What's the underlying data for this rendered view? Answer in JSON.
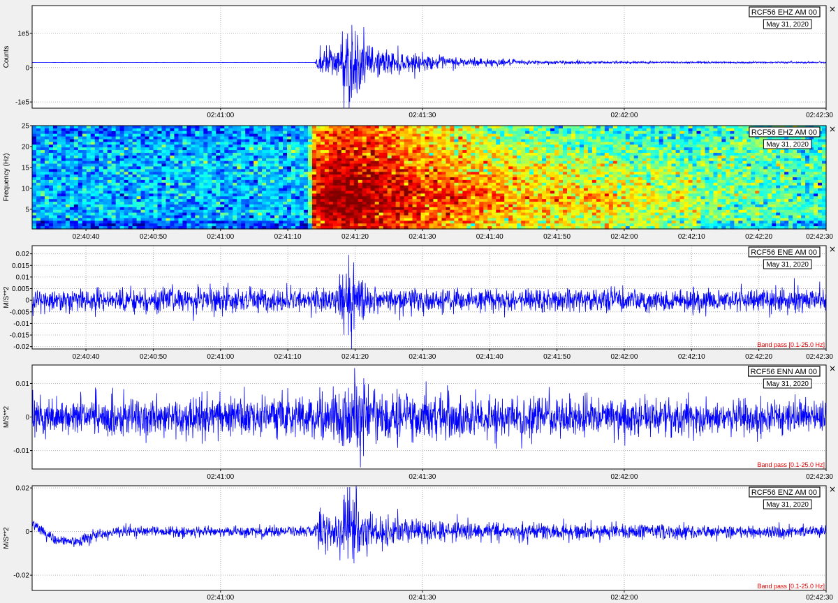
{
  "colors": {
    "trace": "#0000ff",
    "filter_text": "#e00000",
    "grid": "#b0b0b0",
    "plot_bg": "#ffffff",
    "window_bg": "#f0f0f0"
  },
  "close_label": "×",
  "chart_data": [
    {
      "id": "ehz-waveform",
      "type": "line",
      "station": "RCF56 EHZ AM 00",
      "date": "May 31, 2020",
      "ylabel": "Counts",
      "yticks": [
        {
          "v": 100000,
          "label": "1e5"
        },
        {
          "v": 0,
          "label": "0"
        },
        {
          "v": -100000,
          "label": "-1e5"
        }
      ],
      "ylim": [
        -118000,
        180000
      ],
      "xlim": [
        "02:40:32",
        "02:42:30"
      ],
      "xticks": [
        "02:41:00",
        "02:41:30",
        "02:42:00",
        "02:42:30"
      ],
      "baseline": 15000,
      "grid": true,
      "envelope": [
        {
          "x": "02:40:32",
          "amp": 150
        },
        {
          "x": "02:41:14",
          "amp": 150
        },
        {
          "x": "02:41:15",
          "amp": 80000
        },
        {
          "x": "02:41:17",
          "amp": 45000
        },
        {
          "x": "02:41:19",
          "amp": 165000
        },
        {
          "x": "02:41:22",
          "amp": 55000
        },
        {
          "x": "02:41:30",
          "amp": 25000
        },
        {
          "x": "02:41:45",
          "amp": 8000
        },
        {
          "x": "02:42:00",
          "amp": 4000
        },
        {
          "x": "02:42:30",
          "amp": 2500
        }
      ],
      "filter": ""
    },
    {
      "id": "ehz-spectrogram",
      "type": "heatmap",
      "station": "RCF56 EHZ AM 00",
      "date": "May 31, 2020",
      "ylabel": "Frequency (Hz)",
      "yticks": [
        {
          "v": 5,
          "label": "5"
        },
        {
          "v": 10,
          "label": "10"
        },
        {
          "v": 15,
          "label": "15"
        },
        {
          "v": 20,
          "label": "20"
        },
        {
          "v": 25,
          "label": "25"
        }
      ],
      "ylim": [
        0.3,
        25
      ],
      "xlim": [
        "02:40:32",
        "02:42:30"
      ],
      "xticks": [
        "02:40:40",
        "02:40:50",
        "02:41:00",
        "02:41:10",
        "02:41:20",
        "02:41:30",
        "02:41:40",
        "02:41:50",
        "02:42:00",
        "02:42:10",
        "02:42:20",
        "02:42:30"
      ],
      "colormap": "jet",
      "intensity_profile": [
        {
          "x": "02:40:32",
          "level": 0.3
        },
        {
          "x": "02:41:13",
          "level": 0.32
        },
        {
          "x": "02:41:14",
          "level": 0.85
        },
        {
          "x": "02:41:19",
          "level": 0.95
        },
        {
          "x": "02:41:30",
          "level": 0.78
        },
        {
          "x": "02:41:45",
          "level": 0.62
        },
        {
          "x": "02:42:00",
          "level": 0.55
        },
        {
          "x": "02:42:30",
          "level": 0.42
        }
      ],
      "filter": ""
    },
    {
      "id": "ene-acceleration",
      "type": "line",
      "station": "RCF56 ENE AM 00",
      "date": "May 31, 2020",
      "ylabel": "M/S**2",
      "yticks": [
        {
          "v": 0.02,
          "label": "0.02"
        },
        {
          "v": 0.015,
          "label": "0.015"
        },
        {
          "v": 0.01,
          "label": "0.01"
        },
        {
          "v": 0.005,
          "label": "0.005"
        },
        {
          "v": 0,
          "label": "0"
        },
        {
          "v": -0.005,
          "label": "-0.005"
        },
        {
          "v": -0.01,
          "label": "-0.01"
        },
        {
          "v": -0.015,
          "label": "-0.015"
        },
        {
          "v": -0.02,
          "label": "-0.02"
        }
      ],
      "ylim": [
        -0.021,
        0.0235
      ],
      "xlim": [
        "02:40:32",
        "02:42:30"
      ],
      "xticks": [
        "02:40:40",
        "02:40:50",
        "02:41:00",
        "02:41:10",
        "02:41:20",
        "02:41:30",
        "02:41:40",
        "02:41:50",
        "02:42:00",
        "02:42:10",
        "02:42:20",
        "02:42:30"
      ],
      "baseline": 0,
      "grid": true,
      "envelope": [
        {
          "x": "02:40:32",
          "amp": 0.006
        },
        {
          "x": "02:41:17",
          "amp": 0.006
        },
        {
          "x": "02:41:19",
          "amp": 0.022
        },
        {
          "x": "02:41:21",
          "amp": 0.012
        },
        {
          "x": "02:41:24",
          "amp": 0.006
        },
        {
          "x": "02:42:30",
          "amp": 0.006
        }
      ],
      "filter": "Band pass [0.1-25.0 Hz]"
    },
    {
      "id": "enn-acceleration",
      "type": "line",
      "station": "RCF56 ENN AM 00",
      "date": "May 31, 2020",
      "ylabel": "M/S**2",
      "yticks": [
        {
          "v": 0.01,
          "label": "0.01"
        },
        {
          "v": 0,
          "label": "0"
        },
        {
          "v": -0.01,
          "label": "-0.01"
        }
      ],
      "ylim": [
        -0.0155,
        0.0155
      ],
      "xlim": [
        "02:40:32",
        "02:42:30"
      ],
      "xticks": [
        "02:41:00",
        "02:41:30",
        "02:42:00",
        "02:42:30"
      ],
      "baseline": 0,
      "grid": true,
      "envelope": [
        {
          "x": "02:40:32",
          "amp": 0.006
        },
        {
          "x": "02:41:13",
          "amp": 0.007
        },
        {
          "x": "02:41:19",
          "amp": 0.013
        },
        {
          "x": "02:41:24",
          "amp": 0.009
        },
        {
          "x": "02:41:35",
          "amp": 0.007
        },
        {
          "x": "02:42:30",
          "amp": 0.006
        }
      ],
      "filter": "Band pass [0.1-25.0 Hz]"
    },
    {
      "id": "enz-acceleration",
      "type": "line",
      "station": "RCF56 ENZ AM 00",
      "date": "May 31, 2020",
      "ylabel": "M/S**2",
      "yticks": [
        {
          "v": 0.02,
          "label": "0.02"
        },
        {
          "v": 0,
          "label": "0"
        },
        {
          "v": -0.02,
          "label": "-0.02"
        }
      ],
      "ylim": [
        -0.027,
        0.021
      ],
      "xlim": [
        "02:40:32",
        "02:42:30"
      ],
      "xticks": [
        "02:41:00",
        "02:41:30",
        "02:42:00",
        "02:42:30"
      ],
      "baseline": 0,
      "grid": true,
      "envelope": [
        {
          "x": "02:40:32",
          "amp": 0.003
        },
        {
          "x": "02:41:14",
          "amp": 0.003
        },
        {
          "x": "02:41:15",
          "amp": 0.016
        },
        {
          "x": "02:41:17",
          "amp": 0.006
        },
        {
          "x": "02:41:19",
          "amp": 0.025
        },
        {
          "x": "02:41:22",
          "amp": 0.009
        },
        {
          "x": "02:41:35",
          "amp": 0.005
        },
        {
          "x": "02:42:30",
          "amp": 0.003
        }
      ],
      "initial_drift": [
        {
          "x": "02:40:32",
          "v": 0.004
        },
        {
          "x": "02:40:35",
          "v": -0.003
        },
        {
          "x": "02:40:38",
          "v": -0.005
        },
        {
          "x": "02:40:42",
          "v": -0.001
        },
        {
          "x": "02:40:45",
          "v": 0
        }
      ],
      "filter": "Band pass [0.1-25.0 Hz]"
    }
  ]
}
